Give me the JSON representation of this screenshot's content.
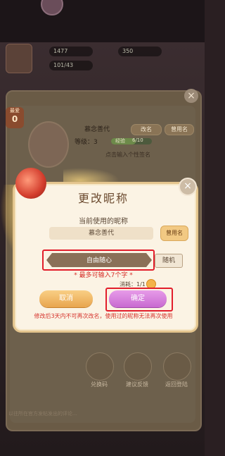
{
  "topbar": {
    "resource_1": "1477",
    "resource_2": "350",
    "resource_3": "101/43"
  },
  "profile_card": {
    "badge_label": "最爱",
    "badge_value": "0",
    "nickname": "慕念善代",
    "level_label": "等级：",
    "level_value": "3",
    "xp_label": "经验",
    "xp_value": "6/10",
    "xp_fraction": 0.6,
    "rename_button": "改名",
    "used_names_button": "曾用名",
    "signature_placeholder": "点击输入个性签名",
    "bottom_buttons": [
      "兑换码",
      "建议反馈",
      "返回登陆"
    ],
    "footer_text": "以往所在官方发帖发出的评论…"
  },
  "dialog": {
    "title": "更改昵称",
    "current_label": "当前使用的昵称",
    "current_name": "慕念善代",
    "used_names_button": "曾用名",
    "input_value": "自由随心",
    "random_button": "随机",
    "hint": "* 最多可输入7个字 *",
    "cost_label": "消耗：1/1",
    "cancel_button": "取消",
    "confirm_button": "确定",
    "warning": "修改后3天内不可再次改名，使用过的昵称无法再次使用",
    "close_label": "×"
  },
  "colors": {
    "dialog_bg": "#fbf3e4",
    "highlight_red": "#e21e2b",
    "confirm": "#c86ad1",
    "cancel": "#e8a54e",
    "warning_text": "#d5312a"
  }
}
